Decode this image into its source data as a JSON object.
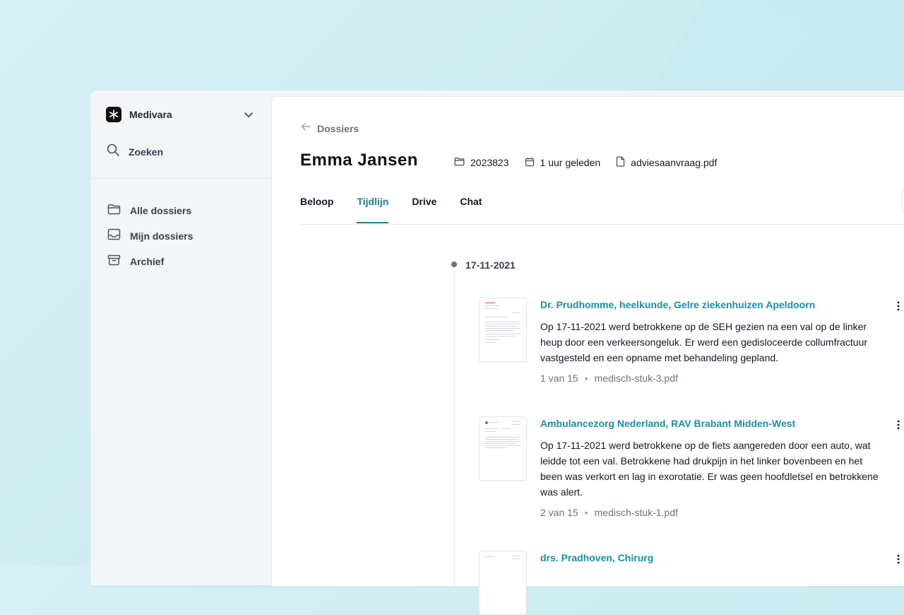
{
  "brand": {
    "name": "Medivara"
  },
  "sidebar": {
    "search_label": "Zoeken",
    "items": [
      {
        "label": "Alle dossiers",
        "icon": "folder-icon"
      },
      {
        "label": "Mijn dossiers",
        "icon": "inbox-icon"
      },
      {
        "label": "Archief",
        "icon": "archive-icon"
      }
    ]
  },
  "header": {
    "back_label": "Dossiers",
    "title": "Emma Jansen",
    "dossier_number": "2023823",
    "updated": "1 uur geleden",
    "file": "adviesaanvraag.pdf"
  },
  "tabs": [
    {
      "label": "Beloop",
      "active": false
    },
    {
      "label": "Tijdlijn",
      "active": true
    },
    {
      "label": "Drive",
      "active": false
    },
    {
      "label": "Chat",
      "active": false
    }
  ],
  "timeline": {
    "date": "17-11-2021",
    "entries": [
      {
        "title": "Dr. Prudhomme, heelkunde, Gelre ziekenhuizen Apeldoorn",
        "body": "Op 17-11-2021 werd betrokkene op de SEH gezien na een val op de linker heup door een verkeersongeluk. Er werd een gedisloceerde collumfractuur vastgesteld en een opname met behandeling gepland.",
        "page": "1 van 15",
        "file": "medisch-stuk-3.pdf"
      },
      {
        "title": "Ambulancezorg Nederland, RAV Brabant Midden-West",
        "body": "Op 17-11-2021 werd betrokkene op de fiets aangereden door een auto, wat leidde tot een val. Betrokkene had drukpijn in het linker bovenbeen en het been was verkort en lag in exorotatie. Er was geen hoofdletsel en betrokkene was alert.",
        "page": "2 van 15",
        "file": "medisch-stuk-1.pdf"
      },
      {
        "title": "drs. Pradhoven, Chirurg"
      }
    ]
  },
  "colors": {
    "accent": "#1a7f93",
    "link": "#1a8fa3"
  }
}
